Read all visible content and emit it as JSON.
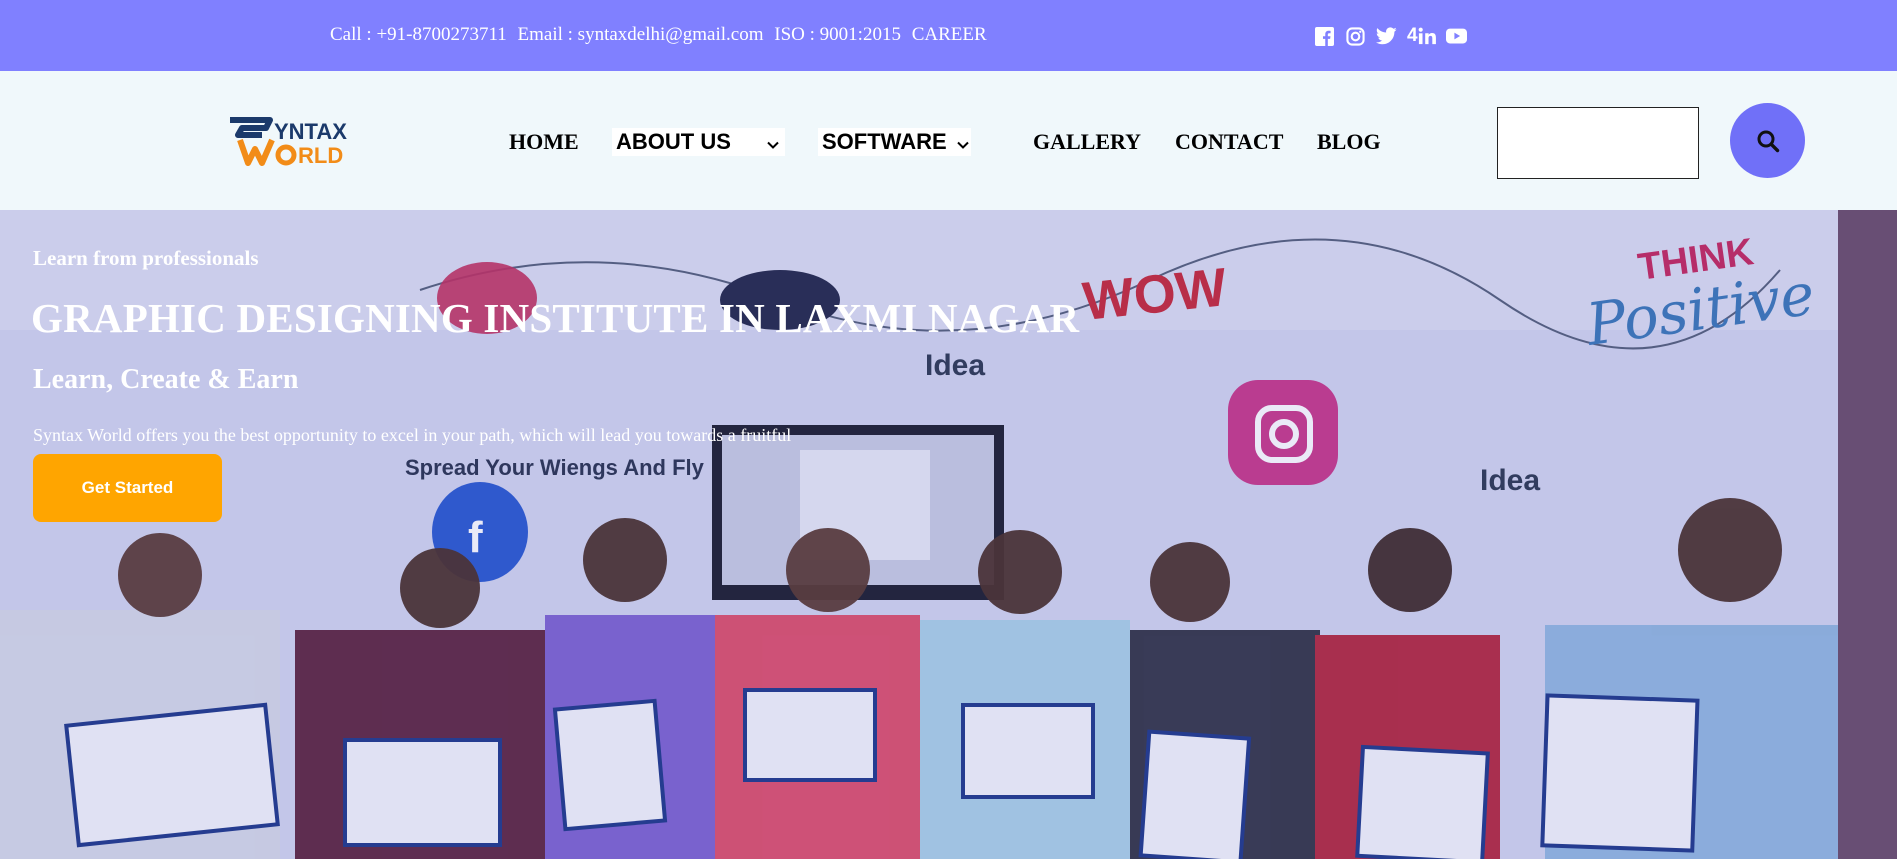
{
  "topbar": {
    "call": "Call : +91-8700273711",
    "email": "Email : syntaxdelhi@gmail.com",
    "iso": "ISO : 9001:2015",
    "career": "CAREER",
    "social_icons": [
      "facebook-icon",
      "instagram-icon",
      "twitter-icon",
      "linkedin-icon",
      "youtube-icon"
    ],
    "linkedin_prefix": "4"
  },
  "header": {
    "logo_text": "SYNTAX WORLD",
    "nav": {
      "home": "HOME",
      "about": "ABOUT US",
      "software": "SOFTWARE",
      "gallery": "GALLERY",
      "contact": "CONTACT",
      "blog": "BLOG"
    },
    "search_placeholder": ""
  },
  "hero": {
    "kicker": "Learn from professionals",
    "title": "GRAPHIC DESIGNING INSTITUTE IN LAXMI NAGAR",
    "subtitle": "Learn, Create & Earn",
    "description": "Syntax World offers you the best opportunity to excel in your path, which will lead you towards a fruitful",
    "cta_label": "Get Started"
  },
  "colors": {
    "topbar": "#8080ff",
    "header_bg": "#f0f8fb",
    "search_button": "#7070f8",
    "cta": "#ffa500"
  }
}
